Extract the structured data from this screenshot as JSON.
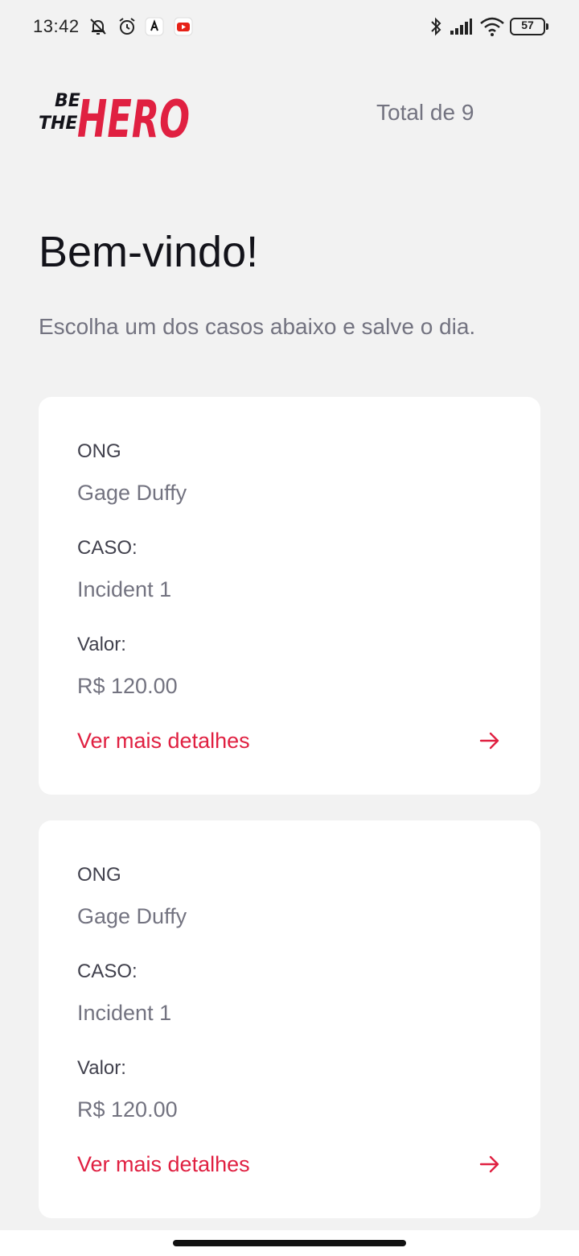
{
  "status_bar": {
    "time": "13:42",
    "icons": [
      "bell-muted-icon",
      "alarm-icon",
      "app-icon",
      "youtube-icon",
      "bluetooth-icon",
      "signal-icon",
      "wifi-icon"
    ],
    "battery": "57"
  },
  "header": {
    "logo_line1": "BE",
    "logo_line2": "THE",
    "logo_word": "HERO",
    "total": "Total de 9"
  },
  "welcome": {
    "title": "Bem-vindo!",
    "subtitle": "Escolha um dos casos abaixo e salve o dia."
  },
  "cases": [
    {
      "ong_label": "ONG",
      "ong": "Gage Duffy",
      "caso_label": "CASO:",
      "caso": "Incident 1",
      "valor_label": "Valor:",
      "valor": "R$ 120.00",
      "details": "Ver mais detalhes"
    },
    {
      "ong_label": "ONG",
      "ong": "Gage Duffy",
      "caso_label": "CASO:",
      "caso": "Incident 1",
      "valor_label": "Valor:",
      "valor": "R$ 120.00",
      "details": "Ver mais detalhes"
    }
  ],
  "colors": {
    "brand": "#e02041",
    "background": "#f2f2f2",
    "title": "#13131a",
    "muted": "#737380",
    "label": "#41414d"
  }
}
